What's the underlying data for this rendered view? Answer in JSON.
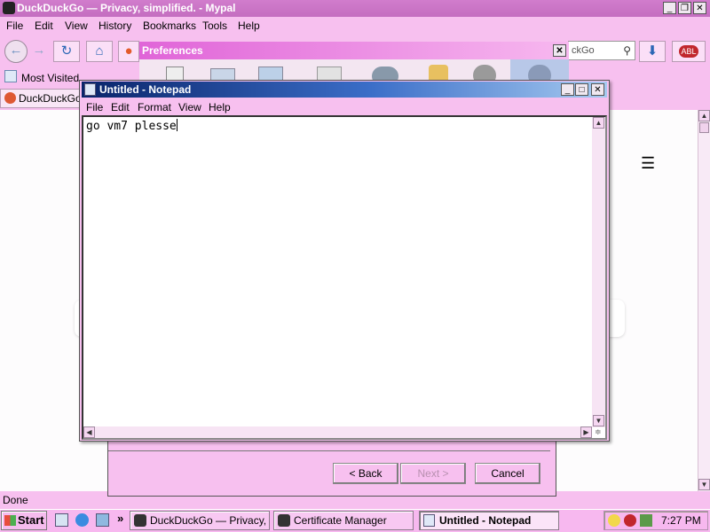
{
  "browser": {
    "title": "DuckDuckGo — Privacy, simplified. - Mypal",
    "menu": [
      "File",
      "Edit",
      "View",
      "History",
      "Bookmarks",
      "Tools",
      "Help"
    ],
    "search_partial": "ckGo",
    "bookmark": "Most Visited",
    "tab_label": "DuckDuckGo -",
    "status": "Done",
    "addon_badge": "ABL"
  },
  "preferences": {
    "title": "Preferences",
    "back_label": "< Back",
    "next_label": "Next >",
    "cancel_label": "Cancel"
  },
  "notepad": {
    "title": "Untitled - Notepad",
    "menu": [
      "File",
      "Edit",
      "Format",
      "View",
      "Help"
    ],
    "content": "go vm7 plesse"
  },
  "taskbar": {
    "start": "Start",
    "chevron": "»",
    "tasks": [
      {
        "label": "DuckDuckGo — Privacy, ...",
        "active": false
      },
      {
        "label": "Certificate Manager",
        "active": false
      },
      {
        "label": "Untitled - Notepad",
        "active": true
      }
    ],
    "clock": "7:27 PM"
  },
  "colors": {
    "theme_pink": "#f7c0ef",
    "notepad_title_start": "#0a246a",
    "notepad_title_end": "#a6caf0"
  }
}
